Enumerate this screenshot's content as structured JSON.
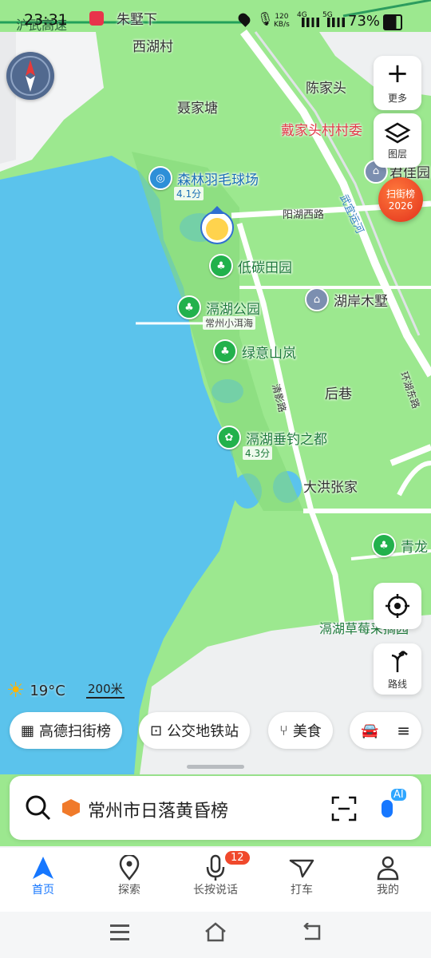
{
  "status": {
    "time": "23:31",
    "carrier": "沪武高速",
    "net_speed_value": "120",
    "net_speed_unit": "KB/s",
    "sig4g": "4G",
    "sig5g": "5G",
    "battery": "73%"
  },
  "map_labels": {
    "zhushuxia": "朱墅下",
    "xihucun": "西湖村",
    "chenjiatou": "陈家头",
    "niejiatang": "聂家塘",
    "daijiatou": "戴家头村村委",
    "yanghu_road": "阳湖西路",
    "wuyi_canal": "武宜运河",
    "junjiayuan": "君佳园",
    "houxiang": "后巷",
    "qingying_road": "清影路",
    "hongzhang": "大洪张家",
    "huanhu_east": "环湖东路",
    "caomei": "滆湖草莓采摘园",
    "qinglong": "青龙"
  },
  "pois": {
    "badminton": {
      "name": "森林羽毛球场",
      "sub": "4.1分"
    },
    "lowcarbon": {
      "name": "低碳田园"
    },
    "gehupark": {
      "name": "滆湖公园",
      "sub": "常州小洱海"
    },
    "lvyi": {
      "name": "绿意山岚"
    },
    "fishing": {
      "name": "滆湖垂钓之都",
      "sub": "4.3分"
    },
    "hu_an": {
      "name": "湖岸木墅"
    }
  },
  "controls": {
    "more": "更多",
    "layers": "图层",
    "rank_badge_title": "扫街榜",
    "rank_badge_year": "2026",
    "route": "路线"
  },
  "weather": {
    "temp": "19°C",
    "scale": "200米"
  },
  "chips": {
    "scan": "高德扫街榜",
    "bus": "公交地铁站",
    "food": "美食"
  },
  "search": {
    "text": "常州市日落黄昏榜",
    "ai": "AI"
  },
  "tabs": {
    "home": "首页",
    "explore": "探索",
    "voice": "长按说话",
    "voice_badge": "12",
    "taxi": "打车",
    "mine": "我的"
  },
  "colors": {
    "water": "#5bc3ec",
    "land": "#9ce88f",
    "road": "#ffffff",
    "accent": "#1677ff",
    "badge": "#f0492c"
  }
}
